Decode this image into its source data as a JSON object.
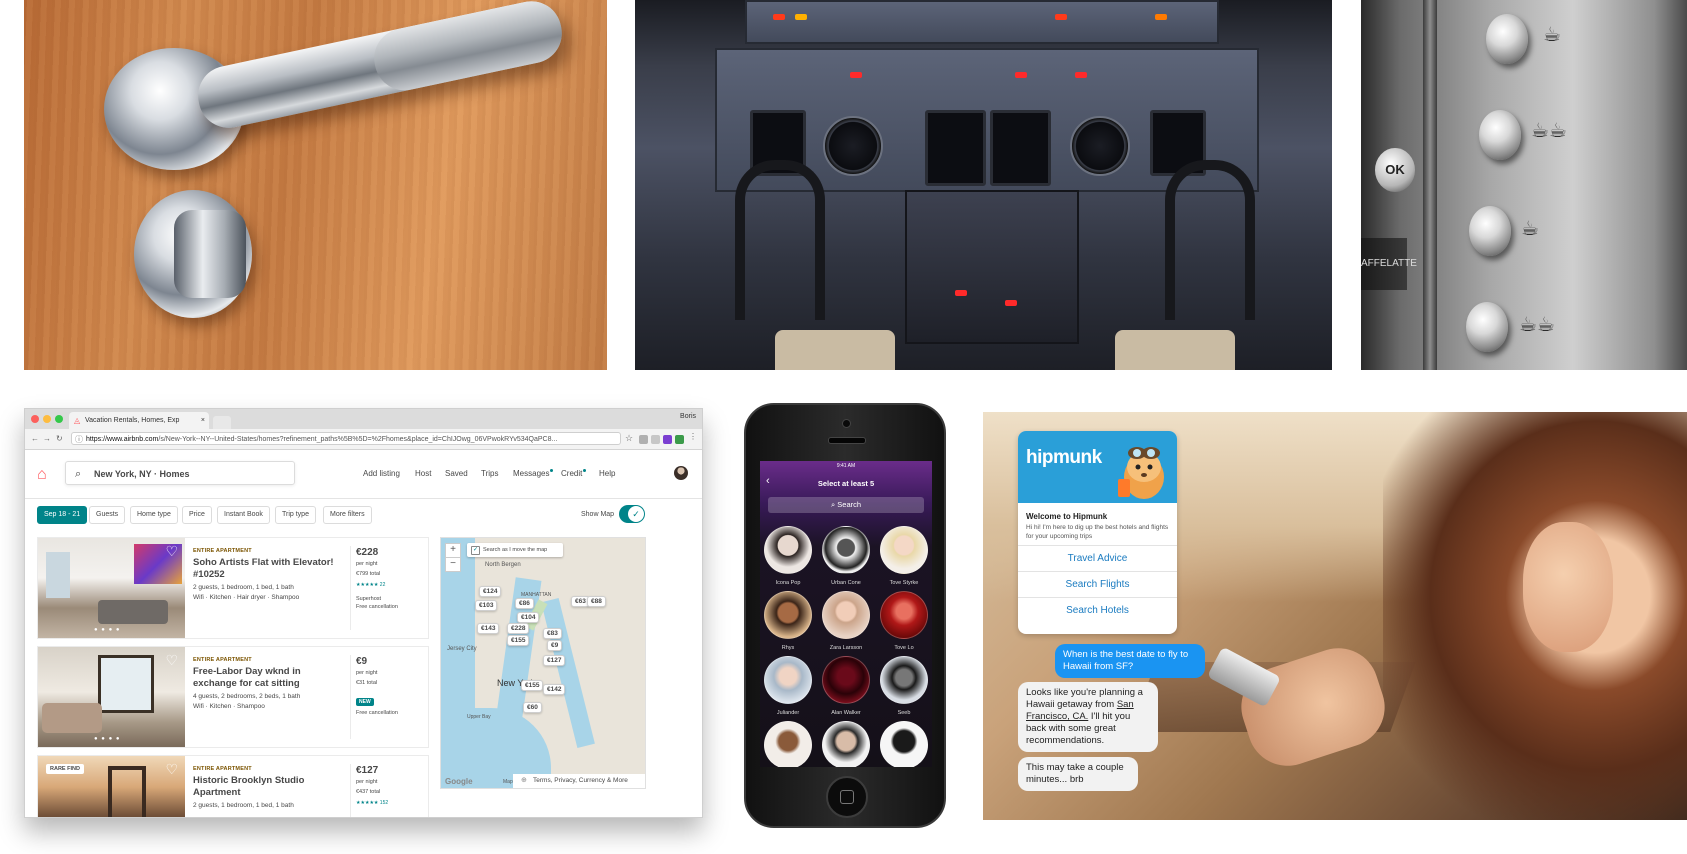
{
  "coffee_panel": {
    "ok_label": "OK",
    "side_label": "AFFELATTE"
  },
  "browser": {
    "tab_title": "Vacation Rentals, Homes, Exp",
    "tab_close": "×",
    "user_name": "Boris",
    "url_host": "https://www.airbnb.com",
    "url_path": "/s/New-York--NY--United-States/homes?refinement_paths%5B%5D=%2Fhomes&place_id=ChIJOwg_06VPwokRYv534QaPC8..."
  },
  "airbnb": {
    "search_value": "New York, NY · Homes",
    "nav": [
      "Add listing",
      "Host",
      "Saved",
      "Trips",
      "Messages",
      "Credit",
      "Help"
    ],
    "filters": [
      "Sep 18 - 21",
      "Guests",
      "Home type",
      "Price",
      "Instant Book",
      "Trip type",
      "More filters"
    ],
    "show_map_label": "Show Map",
    "listings": [
      {
        "kind": "ENTIRE APARTMENT",
        "title": "Soho Artists Flat with Elevator! #10252",
        "specs": "2 guests, 1 bedroom, 1 bed, 1 bath",
        "amenities": "Wifi · Kitchen · Hair dryer · Shampoo",
        "price": "€228",
        "per_night": "per night",
        "total": "€799 total",
        "stars": "★★★★★ 22",
        "badge_line1": "Superhost",
        "badge_line2": "Free cancellation"
      },
      {
        "kind": "ENTIRE APARTMENT",
        "title": "Free-Labor Day wknd in exchange for cat sitting",
        "specs": "4 guests, 2 bedrooms, 2 beds, 1 bath",
        "amenities": "Wifi · Kitchen · Shampoo",
        "price": "€9",
        "per_night": "per night",
        "total": "€31 total",
        "new_label": "NEW",
        "cancel": "Free cancellation"
      },
      {
        "rare_label": "RARE FIND",
        "kind": "ENTIRE APARTMENT",
        "title": "Historic Brooklyn Studio Apartment",
        "specs": "2 guests, 1 bedroom, 1 bed, 1 bath",
        "price": "€127",
        "per_night": "per night",
        "total": "€437 total",
        "stars": "★★★★★ 152"
      }
    ],
    "map": {
      "search_move": "Search as I move the map",
      "zoom_in": "+",
      "zoom_out": "−",
      "pins": [
        "€124",
        "€86",
        "€63",
        "€88",
        "€103",
        "€104",
        "€228",
        "€143",
        "€83",
        "€155",
        "€9",
        "€127",
        "€155",
        "€142",
        "€60"
      ],
      "labels": [
        "North Bergen",
        "MANHATTAN",
        "Jersey City",
        "New York",
        "Upper Bay"
      ],
      "footer": "Terms, Privacy, Currency & More",
      "google": "Google",
      "map_word": "Map"
    }
  },
  "phone_app": {
    "time": "9:41 AM",
    "title": "Select at least 5",
    "search": "Search",
    "artists": [
      "Icona Pop",
      "Urban Cone",
      "Tove Styrke",
      "Rhys",
      "Zara Larsson",
      "Tove Lo",
      "Juliander",
      "Alan Walker",
      "Seeb"
    ]
  },
  "hipmunk": {
    "brand": "hipmunk",
    "welcome": "Welcome to Hipmunk",
    "intro": "Hi hi! I'm here to dig up the best hotels and flights for your upcoming trips",
    "options": [
      "Travel Advice",
      "Search Flights",
      "Search Hotels"
    ],
    "user_message": "When is the best date to fly to Hawaii from SF?",
    "bot_reply_a": "Looks like you're planning a Hawaii getaway from ",
    "bot_reply_link": "San Francisco, CA.",
    "bot_reply_b": " I'll hit you back with some great recommendations.",
    "bot_wait": "This may take a couple minutes... brb"
  },
  "colors": {
    "airbnb": "#ff5a5f",
    "teal": "#008489",
    "hipmunk_blue": "#2a9fd8",
    "chat_blue": "#1a94f2"
  }
}
